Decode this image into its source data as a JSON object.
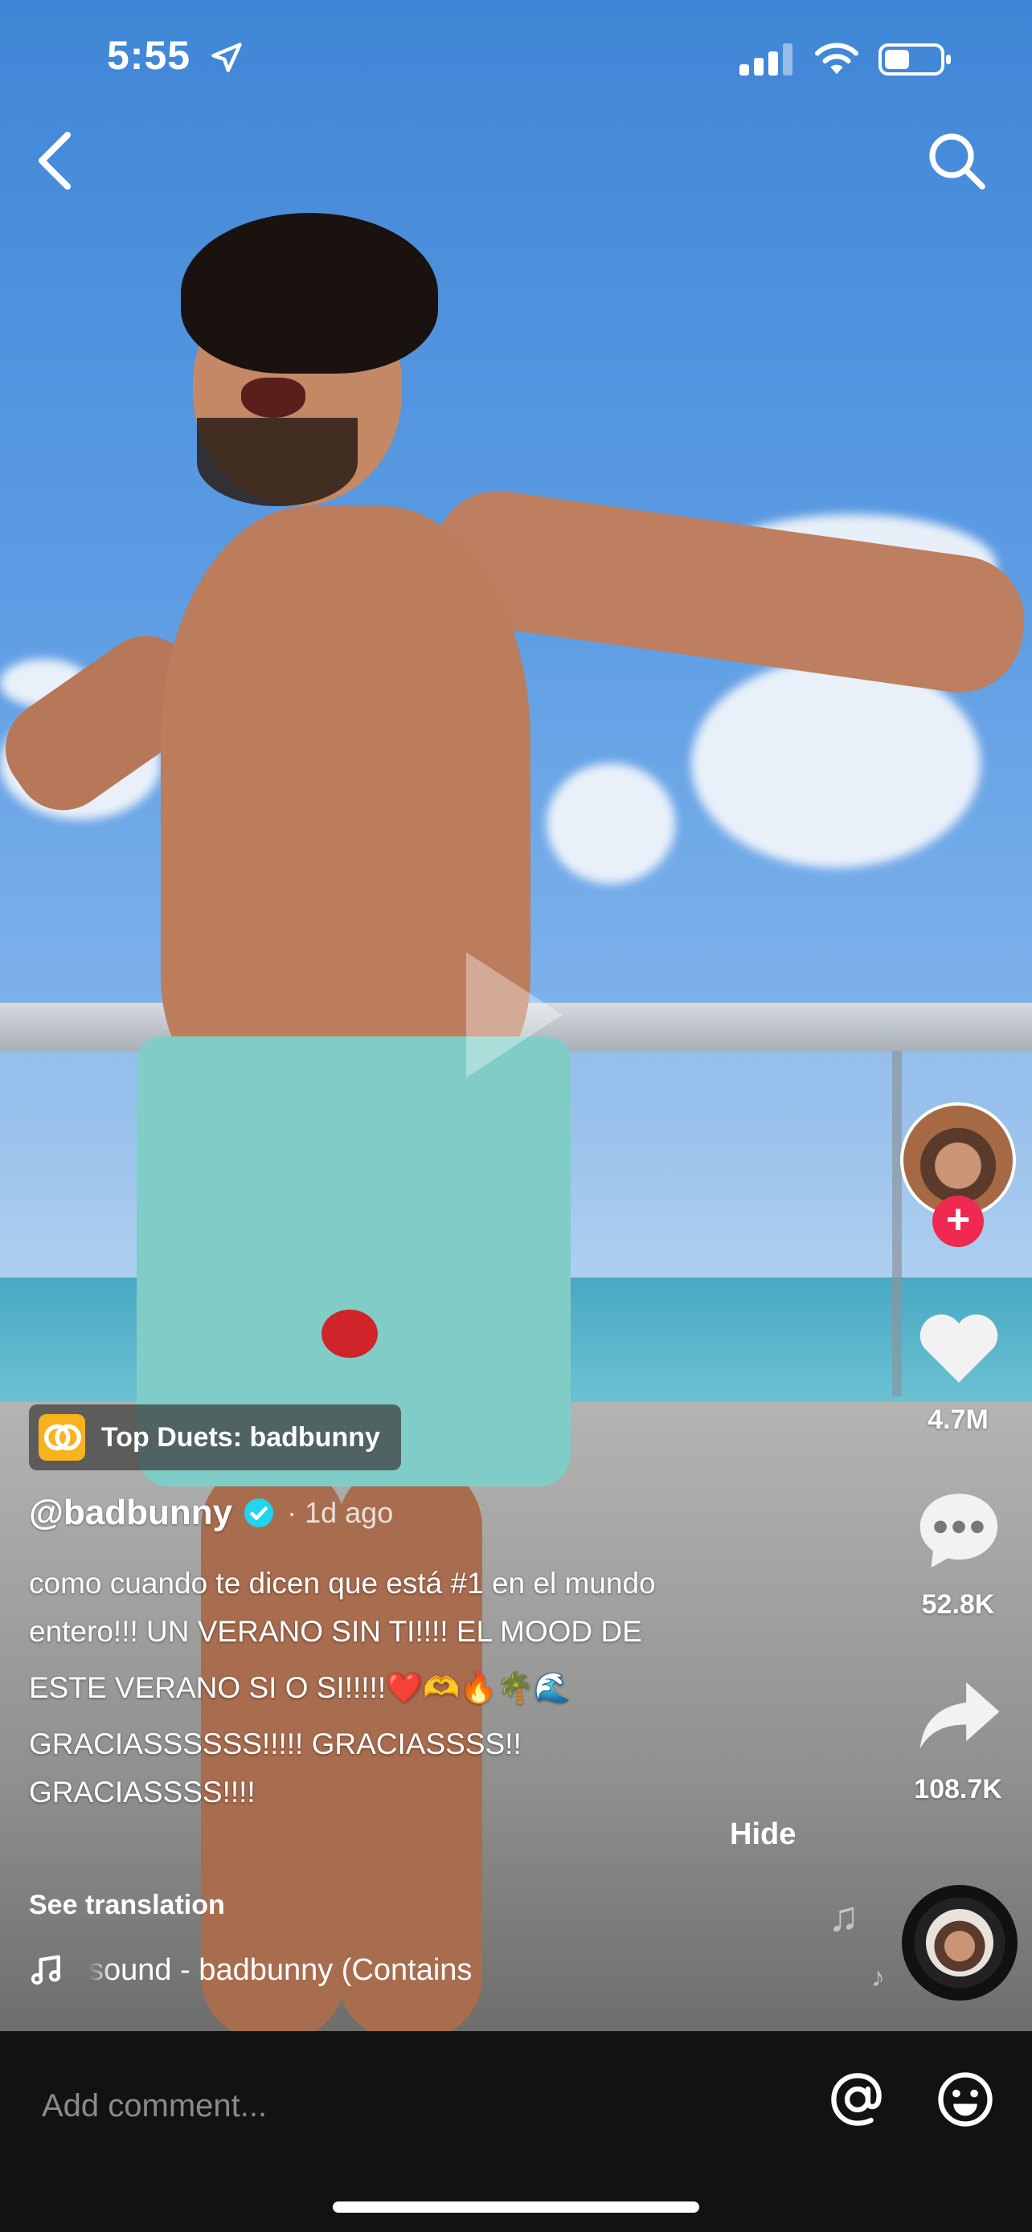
{
  "status_bar": {
    "time": "5:55"
  },
  "badge": {
    "label": "Top Duets: badbunny"
  },
  "post": {
    "username": "@badbunny",
    "age": "· 1d ago",
    "caption_lines": [
      "como cuando te dicen que está #1 en el mundo",
      "entero!!! UN VERANO SIN TI!!!! EL MOOD DE",
      "ESTE VERANO SI O SI!!!!!❤️🫶🔥🌴🌊",
      "GRACIASSSSSS!!!!! GRACIASSSS!!",
      "GRACIASSSS!!!!"
    ],
    "hide_label": "Hide",
    "see_translation": "See translation",
    "sound": "sound - badbunny (Contains"
  },
  "actions": {
    "likes": "4.7M",
    "comments": "52.8K",
    "shares": "108.7K"
  },
  "comment_bar": {
    "placeholder": "Add comment..."
  },
  "colors": {
    "follow": "#ef2950",
    "badge_icon": "#f7b21e",
    "verified": "#20d5ec",
    "comment_bar_bg": "#121212"
  },
  "icons": [
    "location-arrow-icon",
    "signal-icon",
    "wifi-icon",
    "battery-icon",
    "back-chevron-icon",
    "search-icon",
    "plus-icon",
    "heart-icon",
    "comment-bubble-icon",
    "share-arrow-icon",
    "music-note-icon",
    "verified-icon",
    "duet-icon",
    "at-sign-icon",
    "emoji-icon"
  ]
}
